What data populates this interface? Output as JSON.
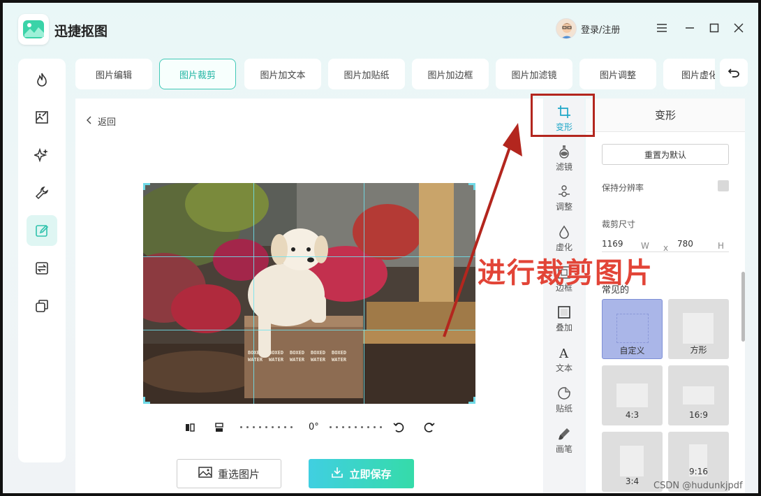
{
  "app": {
    "title": "迅捷抠图",
    "login": "登录/注册"
  },
  "window_controls": [
    "menu-icon",
    "minimize-icon",
    "maximize-icon",
    "close-icon"
  ],
  "sidebar": {
    "items": [
      {
        "icon": "flame-icon"
      },
      {
        "icon": "image-edit-icon"
      },
      {
        "icon": "sparkle-icon"
      },
      {
        "icon": "wrench-icon"
      },
      {
        "icon": "edit-icon",
        "active": true
      },
      {
        "icon": "convert-icon"
      },
      {
        "icon": "copy-icon"
      }
    ]
  },
  "tabs": [
    {
      "label": "图片编辑"
    },
    {
      "label": "图片裁剪",
      "active": true
    },
    {
      "label": "图片加文本"
    },
    {
      "label": "图片加贴纸"
    },
    {
      "label": "图片加边框"
    },
    {
      "label": "图片加滤镜"
    },
    {
      "label": "图片调整"
    },
    {
      "label": "图片虚化"
    }
  ],
  "canvas": {
    "back_label": "返回",
    "rotation": "0°",
    "reselect_label": "重选图片",
    "save_label": "立即保存"
  },
  "tools": [
    {
      "label": "变形",
      "icon": "crop-icon",
      "active": true
    },
    {
      "label": "滤镜",
      "icon": "flask-icon"
    },
    {
      "label": "调整",
      "icon": "adjust-icon"
    },
    {
      "label": "虚化",
      "icon": "drop-icon"
    },
    {
      "label": "边框",
      "icon": "frame-icon"
    },
    {
      "label": "叠加",
      "icon": "overlay-icon"
    },
    {
      "label": "文本",
      "icon": "text-icon"
    },
    {
      "label": "贴纸",
      "icon": "sticker-icon"
    },
    {
      "label": "画笔",
      "icon": "brush-icon"
    }
  ],
  "panel": {
    "title": "变形",
    "reset_label": "重置为默认",
    "keep_resolution_label": "保持分辨率",
    "crop_size_label": "裁剪尺寸",
    "width": "1169",
    "width_unit": "W",
    "times": "x",
    "height": "780",
    "height_unit": "H",
    "common_label": "常见的",
    "presets": [
      {
        "label": "自定义",
        "selected": true
      },
      {
        "label": "方形"
      },
      {
        "label": "4:3"
      },
      {
        "label": "16:9"
      },
      {
        "label": "3:4"
      },
      {
        "label": "9:16"
      }
    ]
  },
  "annotation": {
    "text": "进行裁剪图片",
    "color": "#e24437"
  },
  "watermark": "CSDN @hudunkjpdf",
  "colors": {
    "accent": "#40c9b6",
    "save_gradient": [
      "#40cfe1",
      "#35dba9"
    ],
    "annotation_red": "#b3261e"
  }
}
